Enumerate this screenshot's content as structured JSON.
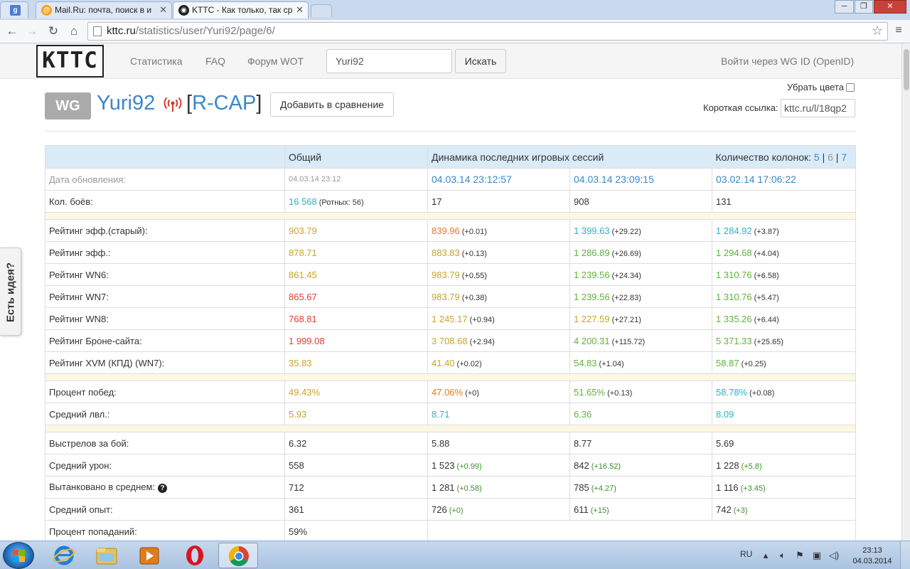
{
  "browser": {
    "tabs": [
      {
        "title": "",
        "favicon": "google-icon"
      },
      {
        "title": "Mail.Ru: почта, поиск в и",
        "favicon": "mailru-icon"
      },
      {
        "title": "KTTC - Как только, так ср",
        "favicon": "kttc-icon"
      }
    ],
    "url_host": "kttc.ru",
    "url_path": "/statistics/user/Yuri92/page/6/"
  },
  "site": {
    "logo": "KTTC",
    "nav": [
      "Статистика",
      "FAQ",
      "Форум WOT"
    ],
    "search_value": "Yuri92",
    "search_button": "Искать",
    "login": "Войти через WG ID (OpenID)",
    "idea_tab": "Есть идея?"
  },
  "player": {
    "badge": "WG",
    "name": "Yuri92",
    "clan_open": "[",
    "clan": "R-CAP",
    "clan_close": "]",
    "compare_button": "Добавить в сравнение",
    "remove_colors": "Убрать цвета",
    "short_link_label": "Короткая ссылка:",
    "short_link": "kttc.ru/l/18qp2"
  },
  "table": {
    "header": {
      "overall": "Общий",
      "dynamics": "Динамика последних игровых сессий",
      "columns_label": "Количество колонок:",
      "col5": "5",
      "col6": "6",
      "col7": "7",
      "sep": "|"
    },
    "date": {
      "label": "Дата обновления:",
      "overall": "04.03.14 23:12",
      "s1": "04.03.14 23:12:57",
      "s2": "04.03.14 23:09:15",
      "s3": "03.02.14 17:06:22"
    },
    "battles": {
      "label": "Кол. боёв:",
      "overall": "16 568",
      "overall_extra": "(Ротных: 56)",
      "s1": "17",
      "s2": "908",
      "s3": "131"
    },
    "ratings": [
      {
        "label": "Рейтинг эфф.(старый):",
        "overall": "903.79",
        "oc": "#c9a32a",
        "s1": "839.96",
        "d1": "(+0.01)",
        "c1": "#e07a1f",
        "s2": "1 399.63",
        "d2": "(+29.22)",
        "c2": "#2ab3c8",
        "s3": "1 284.92",
        "d3": "(+3.87)",
        "c3": "#2ab3c8"
      },
      {
        "label": "Рейтинг эфф.:",
        "overall": "878.71",
        "oc": "#c9a32a",
        "s1": "883.83",
        "d1": "(+0.13)",
        "c1": "#c9a32a",
        "s2": "1 286.89",
        "d2": "(+26.69)",
        "c2": "#5fb33b",
        "s3": "1 294.68",
        "d3": "(+4.04)",
        "c3": "#5fb33b"
      },
      {
        "label": "Рейтинг WN6:",
        "overall": "861.45",
        "oc": "#c9a32a",
        "s1": "983.79",
        "d1": "(+0.55)",
        "c1": "#c9a32a",
        "s2": "1 239.56",
        "d2": "(+24.34)",
        "c2": "#5fb33b",
        "s3": "1 310.76",
        "d3": "(+6.58)",
        "c3": "#5fb33b"
      },
      {
        "label": "Рейтинг WN7:",
        "overall": "865.67",
        "oc": "#d94030",
        "s1": "983.79",
        "d1": "(+0.38)",
        "c1": "#c9a32a",
        "s2": "1 239.56",
        "d2": "(+22.83)",
        "c2": "#5fb33b",
        "s3": "1 310.76",
        "d3": "(+5.47)",
        "c3": "#5fb33b"
      },
      {
        "label": "Рейтинг WN8:",
        "overall": "768.81",
        "oc": "#d94030",
        "s1": "1 245.17",
        "d1": "(+0.94)",
        "c1": "#c9a32a",
        "s2": "1 227.59",
        "d2": "(+27.21)",
        "c2": "#c9a32a",
        "s3": "1 335.26",
        "d3": "(+6.44)",
        "c3": "#5fb33b"
      },
      {
        "label": "Рейтинг Броне-сайта:",
        "overall": "1 999.08",
        "oc": "#d94030",
        "s1": "3 708.68",
        "d1": "(+2.94)",
        "c1": "#c9a32a",
        "s2": "4 200.31",
        "d2": "(+115.72)",
        "c2": "#5fb33b",
        "s3": "5 371.33",
        "d3": "(+25.65)",
        "c3": "#5fb33b"
      },
      {
        "label": "Рейтинг XVM (КПД) (WN7):",
        "overall": "35.83",
        "oc": "#c9a32a",
        "s1": "41.40",
        "d1": "(+0.02)",
        "c1": "#c9a32a",
        "s2": "54.83",
        "d2": "(+1.04)",
        "c2": "#5fb33b",
        "s3": "58.87",
        "d3": "(+0.25)",
        "c3": "#5fb33b"
      }
    ],
    "wins": [
      {
        "label": "Процент побед:",
        "overall": "49.43%",
        "oc": "#c9a32a",
        "s1": "47.06%",
        "d1": "(+0)",
        "c1": "#e07a1f",
        "s2": "51.65%",
        "d2": "(+0.13)",
        "c2": "#5fb33b",
        "s3": "58.78%",
        "d3": "(+0.08)",
        "c3": "#2ab3c8"
      },
      {
        "label": "Средний лвл.:",
        "overall": "5.93",
        "oc": "#c9a32a",
        "s1": "8.71",
        "d1": "",
        "c1": "#2ab3c8",
        "s2": "6.36",
        "d2": "",
        "c2": "#5fb33b",
        "s3": "8.09",
        "d3": "",
        "c3": "#2ab3c8"
      }
    ],
    "misc": [
      {
        "label": "Выстрелов за бой:",
        "overall": "6.32",
        "s1": "5.88",
        "d1": "",
        "s2": "8.77",
        "d2": "",
        "s3": "5.69",
        "d3": ""
      },
      {
        "label": "Средний урон:",
        "overall": "558",
        "s1": "1 523",
        "d1": "(+0.99)",
        "s2": "842",
        "d2": "(+16.52)",
        "s3": "1 228",
        "d3": "(+5.8)"
      },
      {
        "label": "Вытанковано в среднем:",
        "overall": "712",
        "help": true,
        "s1": "1 281",
        "d1": "(+0.58)",
        "s2": "785",
        "d2": "(+4.27)",
        "s3": "1 116",
        "d3": "(+3.45)"
      },
      {
        "label": "Средний опыт:",
        "overall": "361",
        "s1": "726",
        "d1": "(+0)",
        "s2": "611",
        "d2": "(+15)",
        "s3": "742",
        "d3": "(+3)"
      }
    ],
    "accuracy": {
      "label": "Процент попаданий:",
      "overall": "59%"
    }
  },
  "taskbar": {
    "apps": [
      "ie-icon",
      "explorer-icon",
      "media-player-icon",
      "opera-icon",
      "chrome-icon"
    ],
    "lang": "RU",
    "time": "23:13",
    "date": "04.03.2014"
  }
}
